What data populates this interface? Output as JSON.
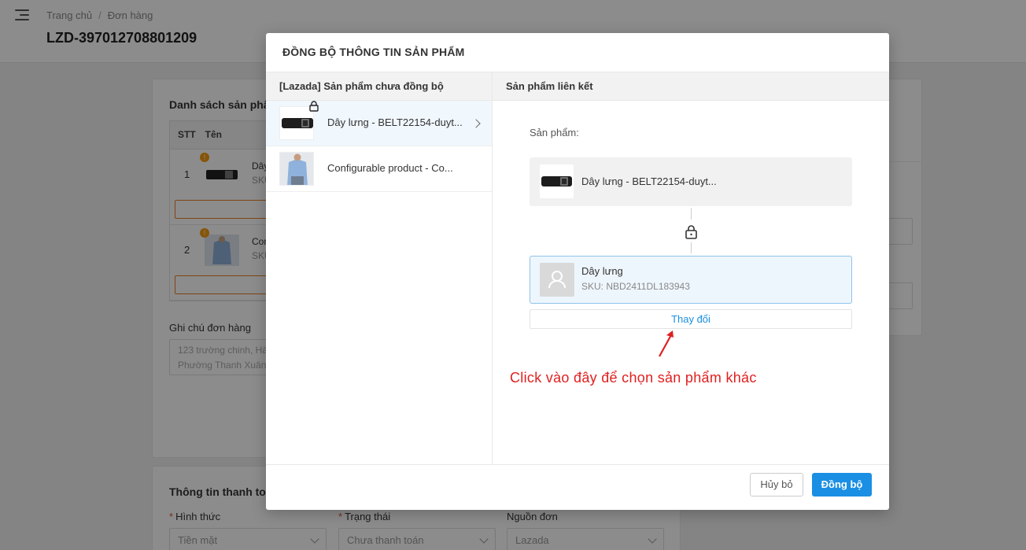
{
  "breadcrumb": {
    "home": "Trang chủ",
    "separator": "/",
    "current": "Đơn hàng"
  },
  "order_code": "LZD-397012708801209",
  "background": {
    "product_list_title": "Danh sách sản phẩ",
    "table_headers": [
      "STT",
      "Tên"
    ],
    "rows": [
      {
        "stt": "1",
        "name": "Dây",
        "sku": "SKU"
      },
      {
        "stt": "2",
        "name": "Con",
        "sku": "SKU"
      }
    ],
    "note_label": "Ghi chú đơn hàng",
    "note_line1": "123 trường chinh, Hà",
    "note_line2": "Phường Thanh Xuân",
    "payment_title": "Thông tin thanh toá",
    "payment_fields": [
      {
        "label": "Hình thức",
        "required": "*",
        "value": "Tiền mặt"
      },
      {
        "label": "Trạng thái",
        "required": "*",
        "value": "Chưa thanh toán"
      },
      {
        "label": "Nguồn đơn",
        "required": "",
        "value": "Lazada"
      }
    ]
  },
  "modal": {
    "title": "ĐỒNG BỘ THÔNG TIN SẢN PHẨM",
    "left_header": "[Lazada] Sản phẩm chưa đồng bộ",
    "right_header": "Sản phẩm liên kết",
    "unsynced_products": [
      {
        "label": "Dây lưng - BELT22154-duyt...",
        "active": true
      },
      {
        "label": "Configurable product - Co...",
        "active": false
      }
    ],
    "product_label": "Sản phẩm:",
    "source_product": "Dây lưng - BELT22154-duyt...",
    "linked_product": {
      "name": "Dây lưng",
      "sku": "SKU: NBD2411DL183943"
    },
    "change_button": "Thay đổi",
    "annotation": "Click vào đây để chọn sản phẩm khác",
    "cancel_button": "Hủy bỏ",
    "sync_button": "Đồng bộ"
  },
  "colors": {
    "primary": "#1a8fe3",
    "annotation": "#e02020",
    "warning": "#f39c12"
  }
}
